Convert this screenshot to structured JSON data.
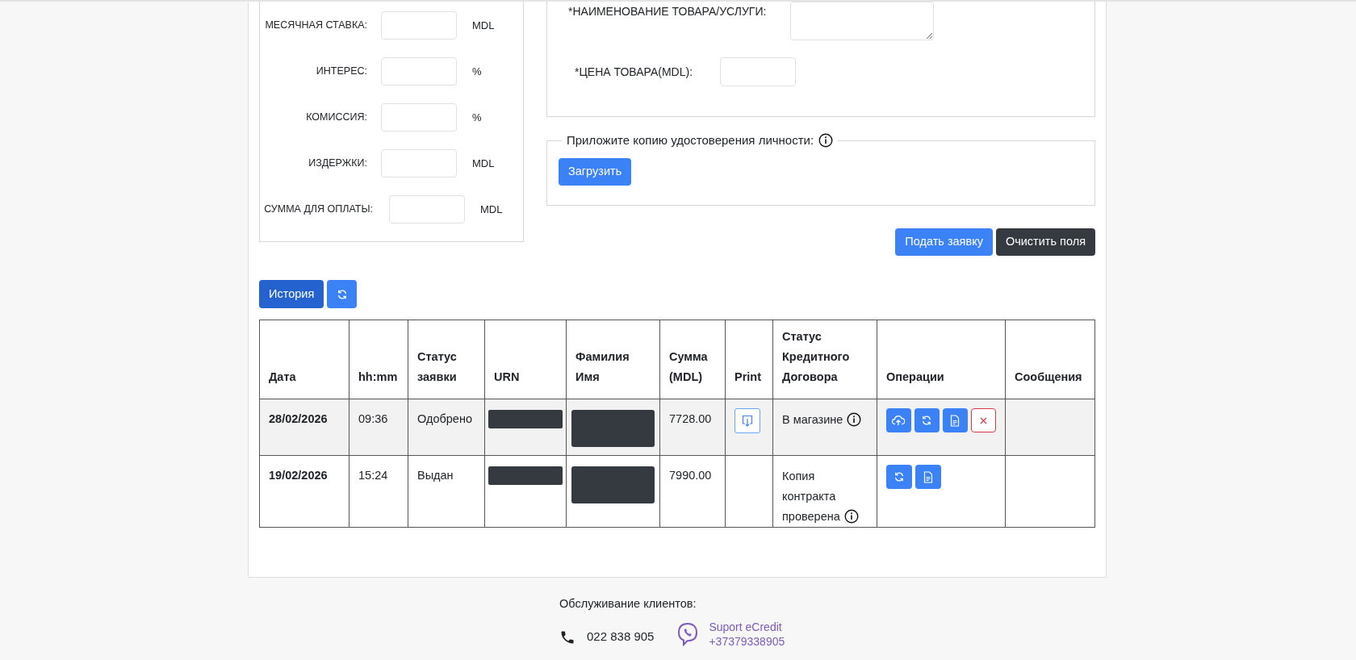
{
  "calc_fields": [
    {
      "label": "МЕСЯЧНАЯ СТАВКА:",
      "unit": "MDL"
    },
    {
      "label": "ИНТЕРЕС:",
      "unit": "%"
    },
    {
      "label": "КОМИССИЯ:",
      "unit": "%"
    },
    {
      "label": "ИЗДЕРЖКИ:",
      "unit": "MDL"
    },
    {
      "label": "СУММА ДЛЯ ОПЛАТЫ:",
      "unit": "MDL"
    }
  ],
  "product": {
    "name_label": "*НАИМЕНОВАНИЕ ТОВАРА/УСЛУГИ:",
    "price_label": "*ЦЕНА ТОВАРА(MDL):"
  },
  "id_copy": {
    "legend": "Приложите копию удостоверения личности:",
    "upload_button": "Загрузить"
  },
  "form_buttons": [
    {
      "label": "Подать заявку",
      "kind": "primary"
    },
    {
      "label": "Очистить поля",
      "kind": "dark"
    }
  ],
  "history_button": "История",
  "table": {
    "columns": [
      "Дата",
      "hh:mm",
      "Статус заявки",
      "URN",
      "Фамилия Имя",
      "Сумма (MDL)",
      "Print",
      "Статус Кредитного Договора",
      "Операции",
      "Сообщения"
    ],
    "rows": [
      {
        "date": "28/02/2026",
        "time": "09:36",
        "status": "Одобрено",
        "urn_redacted": true,
        "name_redacted": true,
        "amount": "7728.00",
        "print": true,
        "contract_status": "В магазине",
        "highlighted": true,
        "operations": [
          {
            "kind": "upload"
          },
          {
            "kind": "refresh"
          },
          {
            "kind": "document"
          },
          {
            "kind": "cancel"
          }
        ]
      },
      {
        "date": "19/02/2026",
        "time": "15:24",
        "status": "Выдан",
        "urn_redacted": true,
        "name_redacted": true,
        "amount": "7990.00",
        "print": false,
        "contract_status": "Копия контракта проверена",
        "highlighted": false,
        "operations": [
          {
            "kind": "refresh"
          },
          {
            "kind": "document"
          }
        ]
      }
    ]
  },
  "footer": {
    "title": "Обслуживание клиентов:",
    "phone": "022 838 905",
    "viber_name": "Suport eCredit",
    "viber_number": "+37379338905"
  }
}
